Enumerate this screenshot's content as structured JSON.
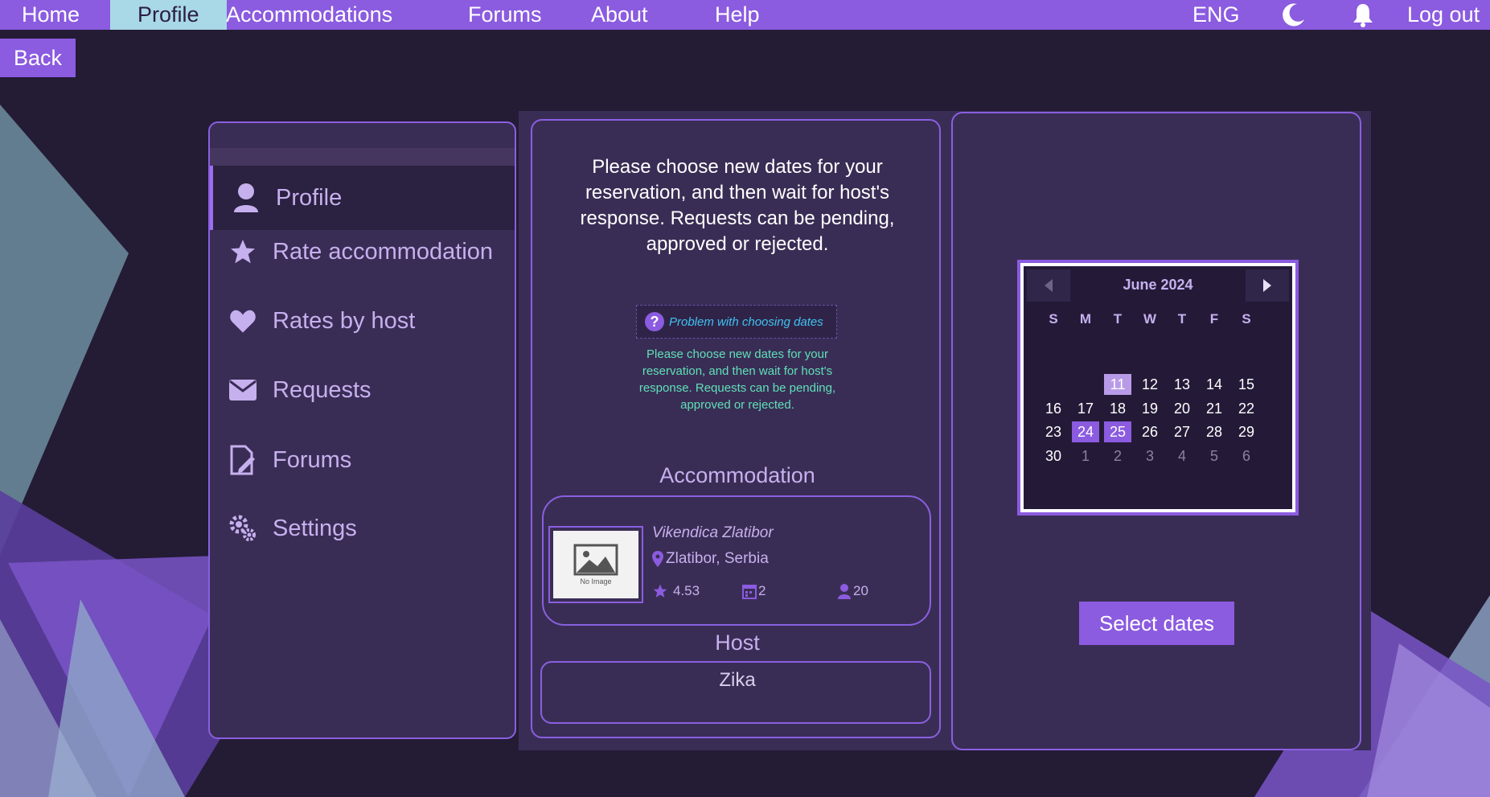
{
  "nav": {
    "home": "Home",
    "profile": "Profile",
    "accommodations": "Accommodations",
    "forums": "Forums",
    "about": "About",
    "help": "Help",
    "language": "ENG",
    "logout": "Log out",
    "theme_icon": "moon-icon",
    "notifications_icon": "bell-icon"
  },
  "back_label": "Back",
  "sidebar": {
    "items": [
      {
        "label": "Profile",
        "icon": "user-icon"
      },
      {
        "label": "Rate accommodation",
        "icon": "star-icon"
      },
      {
        "label": "Rates by host",
        "icon": "heart-icon"
      },
      {
        "label": "Requests",
        "icon": "envelope-icon"
      },
      {
        "label": "Forums",
        "icon": "document-edit-icon"
      },
      {
        "label": "Settings",
        "icon": "gears-icon"
      }
    ]
  },
  "main": {
    "instructions": "Please choose new dates for your reservation, and then wait for host's response. Requests can be pending, approved or rejected.",
    "help_link": "Problem with choosing dates",
    "help_text": "Please choose new dates for your reservation, and then wait for host's response. Requests can be pending, approved or rejected.",
    "accommodation_title": "Accommodation",
    "accommodation": {
      "image_placeholder": "No Image",
      "name": "Vikendica Zlatibor",
      "location": "Zlatibor, Serbia",
      "rating": "4.53",
      "min_days": "2",
      "max_guests": "20"
    },
    "host_title": "Host",
    "host_name": "Zika"
  },
  "calendar": {
    "month": "June 2024",
    "weekdays": [
      "S",
      "M",
      "T",
      "W",
      "T",
      "F",
      "S"
    ],
    "today": "11",
    "selected": [
      "24",
      "25"
    ],
    "unavailable": [
      "12",
      "13",
      "14",
      "15",
      "19",
      "20",
      "26",
      "27"
    ],
    "weeks": [
      [
        "",
        "",
        "11",
        "12",
        "13",
        "14",
        "15"
      ],
      [
        "16",
        "17",
        "18",
        "19",
        "20",
        "21",
        "22"
      ],
      [
        "23",
        "24",
        "25",
        "26",
        "27",
        "28",
        "29"
      ],
      [
        "30",
        "1",
        "2",
        "3",
        "4",
        "5",
        "6"
      ]
    ]
  },
  "select_dates_label": "Select dates",
  "colors": {
    "accent": "#8b5be0",
    "background": "#241b35",
    "panel": "#3a2d55",
    "active_nav": "#a9d8e6",
    "help_link": "#3fc2f0",
    "help_text": "#5fe0b8"
  }
}
